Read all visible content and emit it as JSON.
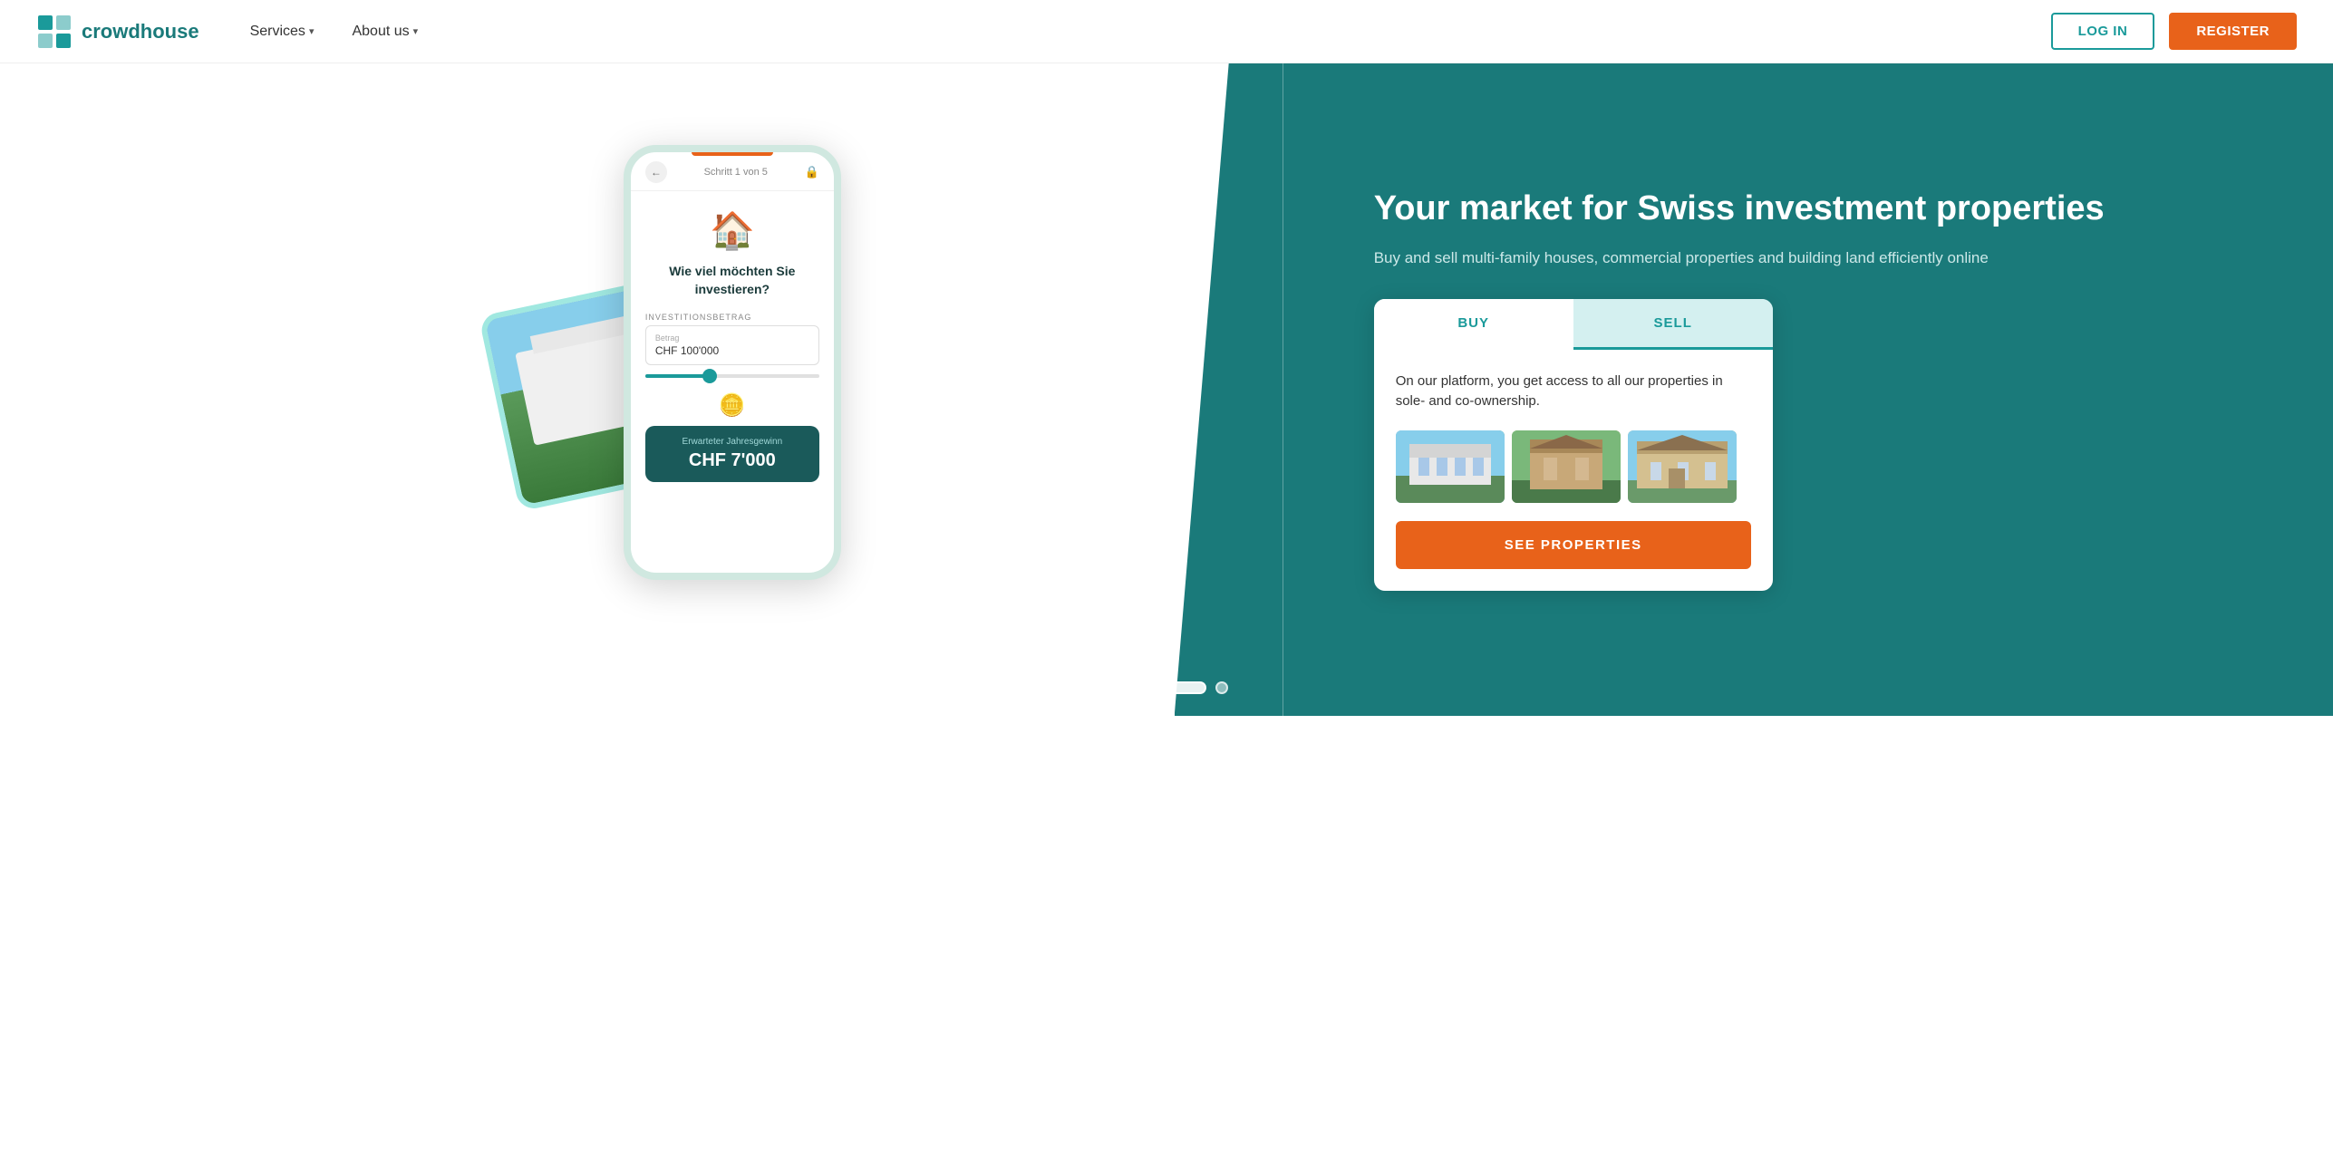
{
  "header": {
    "logo_text": "crowdhouse",
    "nav": [
      {
        "label": "Services",
        "has_dropdown": true
      },
      {
        "label": "About us",
        "has_dropdown": true
      }
    ],
    "login_label": "LOG IN",
    "register_label": "REGISTER"
  },
  "hero": {
    "headline": "Your market for Swiss investment properties",
    "subtext": "Buy and sell multi-family houses, commercial properties and building land efficiently online",
    "tabs": [
      {
        "label": "BUY",
        "active": false
      },
      {
        "label": "SELL",
        "active": true
      }
    ],
    "card_description": "On our platform, you get access to all our properties in sole- and co-ownership.",
    "see_properties_label": "SEE PROPERTIES"
  },
  "phone": {
    "step_label": "Schritt 1 von 5",
    "back_label": "←",
    "question": "Wie viel möchten Sie investieren?",
    "investment_label": "INVESTITIONSBETRAG",
    "betrag_label": "Betrag",
    "amount_value": "CHF 100'000",
    "result_label": "Erwarteter Jahresgewinn",
    "result_value": "CHF 7'000"
  },
  "pagination": {
    "dots": [
      {
        "active": false
      },
      {
        "active": false
      },
      {
        "active": false
      },
      {
        "active": true
      },
      {
        "active": false
      }
    ]
  }
}
